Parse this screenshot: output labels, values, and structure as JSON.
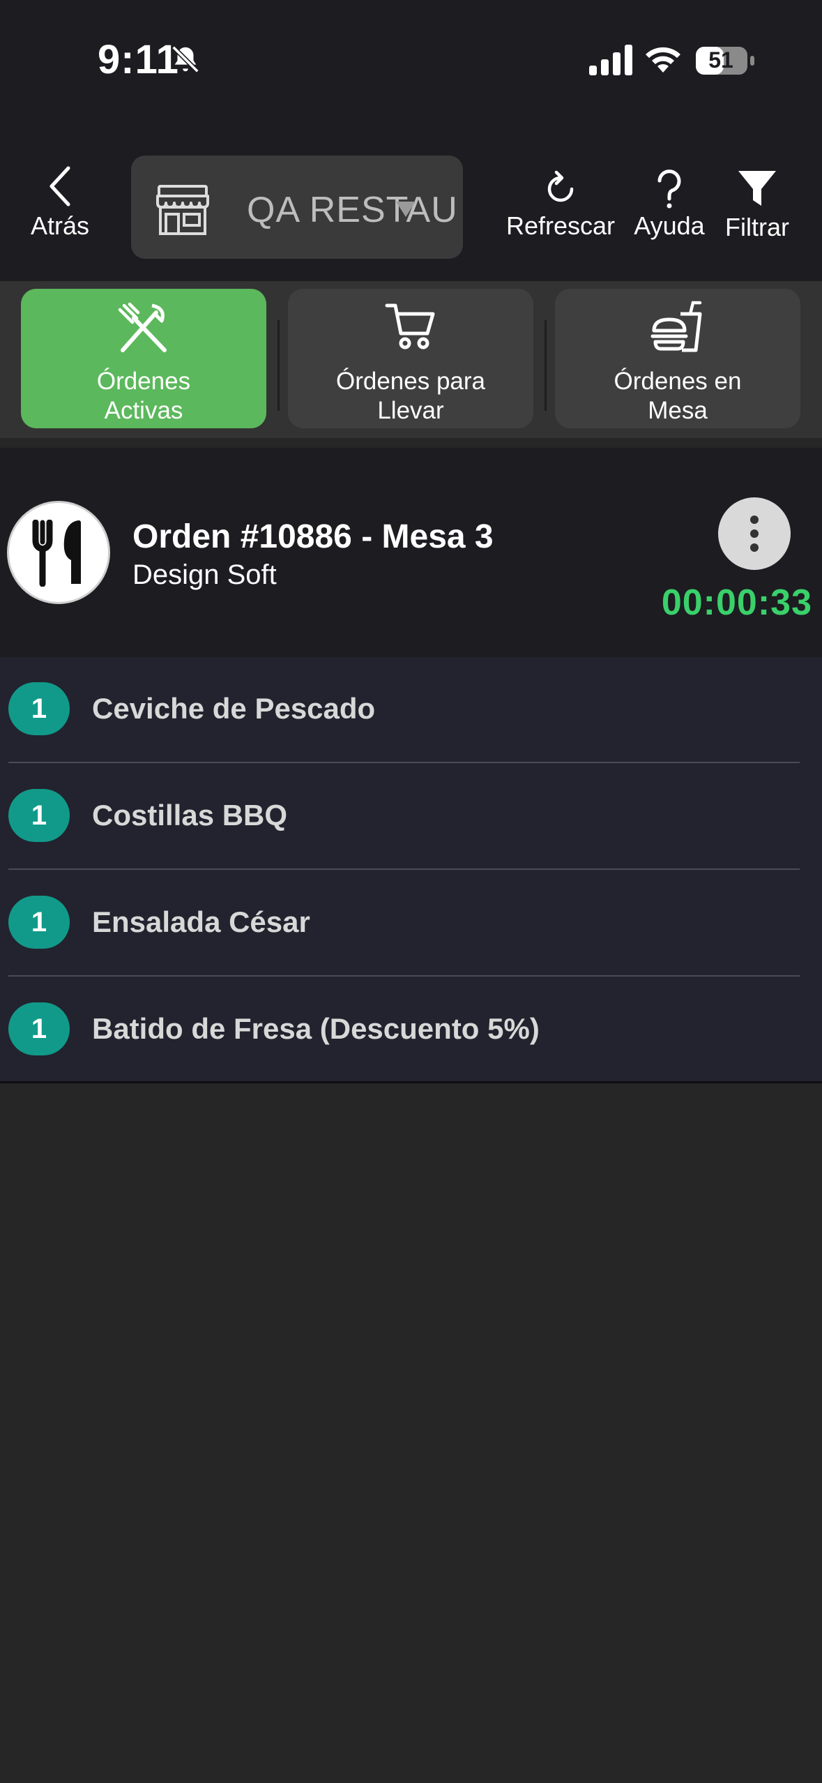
{
  "status_bar": {
    "time": "9:11",
    "battery_level": "51",
    "icons": [
      "bell-slash-icon",
      "cellular-signal-icon",
      "wifi-icon",
      "battery-icon"
    ]
  },
  "toolbar": {
    "back_label": "Atrás",
    "store_name": "QA RESTAU...",
    "refresh_label": "Refrescar",
    "help_label": "Ayuda",
    "filter_label": "Filtrar"
  },
  "tabs": [
    {
      "label": "Órdenes Activas",
      "icon": "utensils-crossed-icon",
      "active": true
    },
    {
      "label": "Órdenes para Llevar",
      "icon": "shopping-cart-icon",
      "active": false
    },
    {
      "label": "Órdenes en Mesa",
      "icon": "burger-drink-icon",
      "active": false
    }
  ],
  "order": {
    "title": "Orden #10886 - Mesa 3",
    "subtitle": "Design Soft",
    "timer": "00:00:33",
    "items": [
      {
        "qty": "1",
        "name": "Ceviche de Pescado"
      },
      {
        "qty": "1",
        "name": "Costillas BBQ"
      },
      {
        "qty": "1",
        "name": "Ensalada César"
      },
      {
        "qty": "1",
        "name": "Batido de Fresa (Descuento 5%)"
      }
    ]
  },
  "colors": {
    "accent_green": "#5cb85c",
    "timer_green": "#3ad06a",
    "qty_teal": "#119a8a",
    "header_bg": "#1c1c21"
  }
}
